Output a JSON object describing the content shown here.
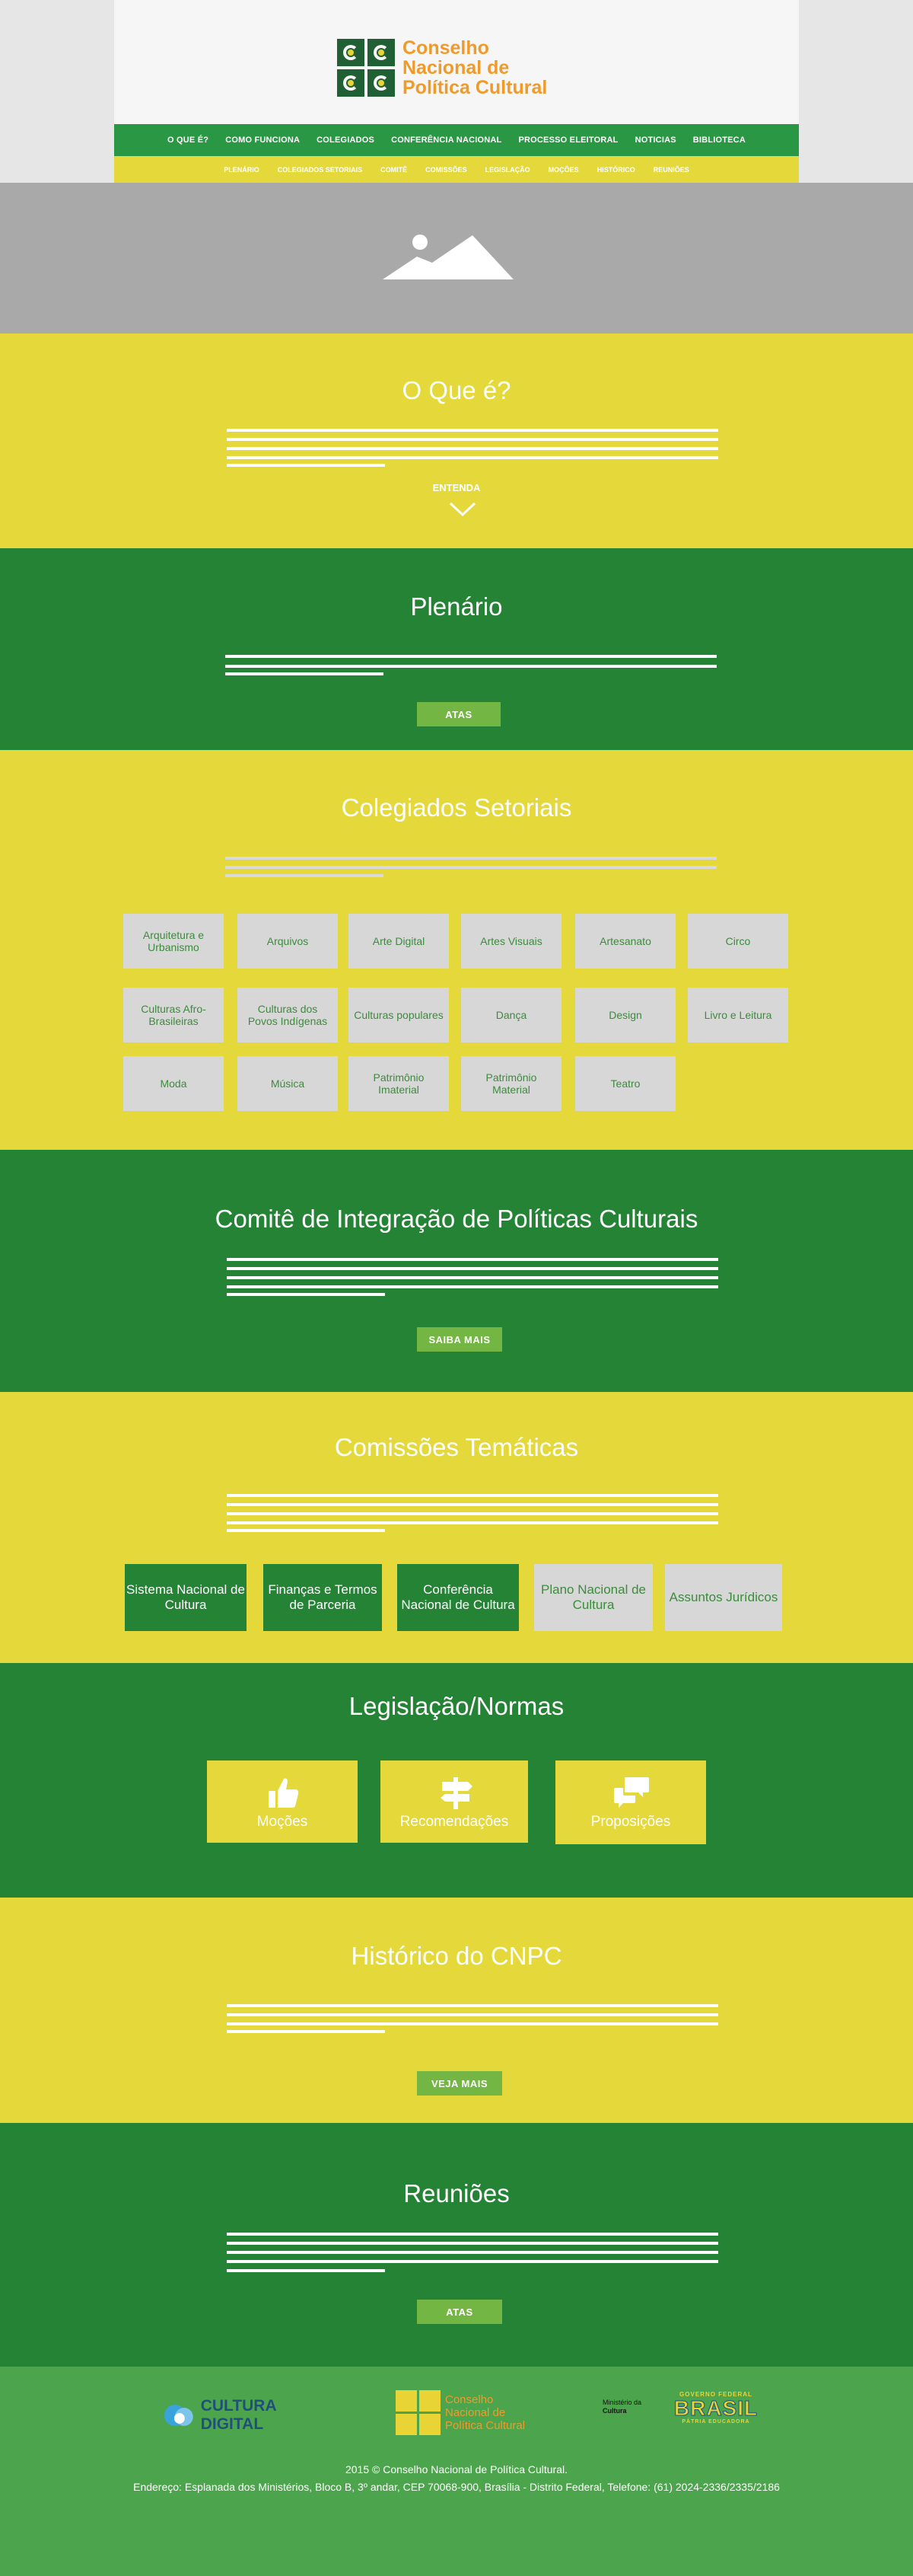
{
  "header": {
    "logo_line1": "Conselho",
    "logo_line2": "Nacional de",
    "logo_line3": "Política Cultural"
  },
  "nav_primary": [
    "O QUE É?",
    "COMO FUNCIONA",
    "COLEGIADOS",
    "CONFERÊNCIA NACIONAL",
    "PROCESSO ELEITORAL",
    "NOTICIAS",
    "BIBLIOTECA"
  ],
  "nav_secondary": [
    "PLENÁRIO",
    "COLEGIADOS SETORIAIS",
    "COMITÊ",
    "COMISSÕES",
    "LEGISLAÇÃO",
    "MOÇÕES",
    "HISTÓRICO",
    "REUNIÕES"
  ],
  "hero": {
    "icon": "image-placeholder-icon"
  },
  "o_que_e": {
    "title": "O Que é?",
    "link": "ENTENDA"
  },
  "plenario": {
    "title": "Plenário",
    "button": "ATAS"
  },
  "colegiados": {
    "title": "Colegiados Setoriais",
    "items": [
      "Arquitetura e Urbanismo",
      "Arquivos",
      "Arte Digital",
      "Artes Visuais",
      "Artesanato",
      "Circo",
      "Culturas Afro-Brasileiras",
      "Culturas dos Povos Indígenas",
      "Culturas populares",
      "Dança",
      "Design",
      "Livro e Leitura",
      "Moda",
      "Música",
      "Patrimônio Imaterial",
      "Patrimônio Material",
      "Teatro"
    ]
  },
  "comite": {
    "title": "Comitê de Integração de Políticas Culturais",
    "button": "SAIBA MAIS"
  },
  "comissoes": {
    "title": "Comissões Temáticas",
    "items": [
      "Sistema Nacional de Cultura",
      "Finanças e Termos de Parceria",
      "Conferência Nacional de Cultura",
      "Plano Nacional de Cultura",
      "Assuntos Jurídicos"
    ]
  },
  "legislacao": {
    "title": "Legislação/Normas",
    "items": [
      {
        "label": "Moções",
        "icon": "thumbs-up-icon"
      },
      {
        "label": "Recomendações",
        "icon": "signpost-icon"
      },
      {
        "label": "Proposições",
        "icon": "chat-bubbles-icon"
      }
    ]
  },
  "historico": {
    "title": "Histórico do CNPC",
    "button": "VEJA MAIS"
  },
  "reunioes": {
    "title": "Reuniões",
    "button": "ATAS"
  },
  "footer": {
    "cultura_digital": "CULTURA DIGITAL",
    "logo_line1": "Conselho",
    "logo_line2": "Nacional de",
    "logo_line3": "Política Cultural",
    "ministerio_line1": "Ministério da",
    "ministerio_line2": "Cultura",
    "governo": "GOVERNO FEDERAL",
    "brasil": "BRASIL",
    "patria": "PÁTRIA EDUCADORA",
    "copyright": "2015 © Conselho Nacional de Política Cultural.",
    "address": "Endereço: Esplanada dos Ministérios, Bloco B, 3º andar, CEP 70068-900, Brasília - Distrito Federal, Telefone: (61) 2024-2336/2335/2186"
  },
  "colors": {
    "green": "#248334",
    "yellow": "#e4d83a",
    "nav_green": "#2a9744",
    "button_green": "#74b643",
    "orange": "#f09a2a"
  }
}
